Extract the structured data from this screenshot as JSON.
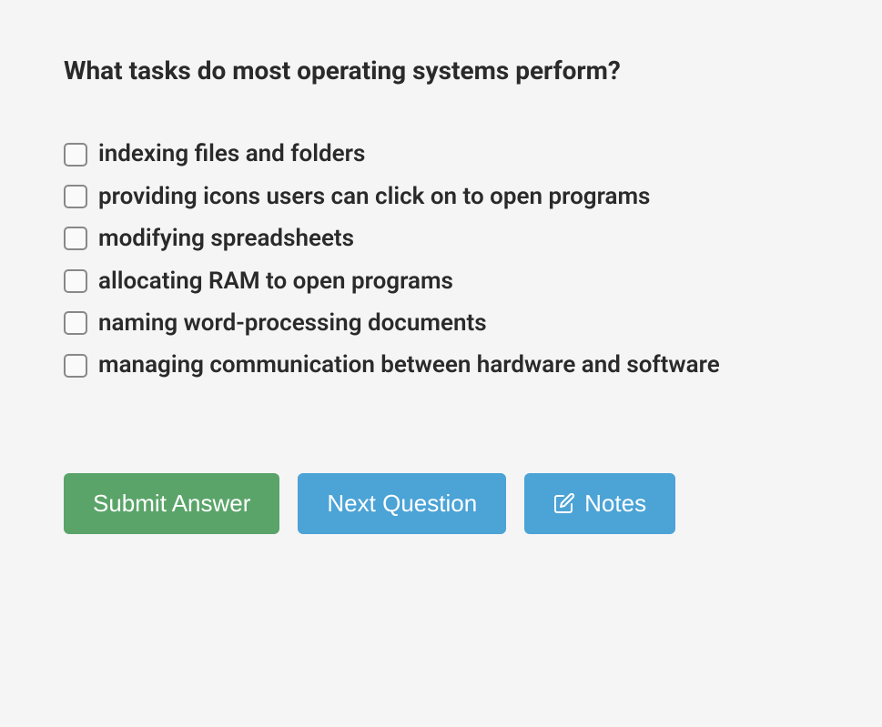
{
  "question": {
    "text": "What tasks do most operating systems perform?",
    "options": [
      "indexing files and folders",
      "providing icons users can click on to open programs",
      "modifying spreadsheets",
      "allocating RAM to open programs",
      "naming word-processing documents",
      "managing communication between hardware and software"
    ]
  },
  "buttons": {
    "submit": "Submit Answer",
    "next": "Next Question",
    "notes": "Notes"
  }
}
